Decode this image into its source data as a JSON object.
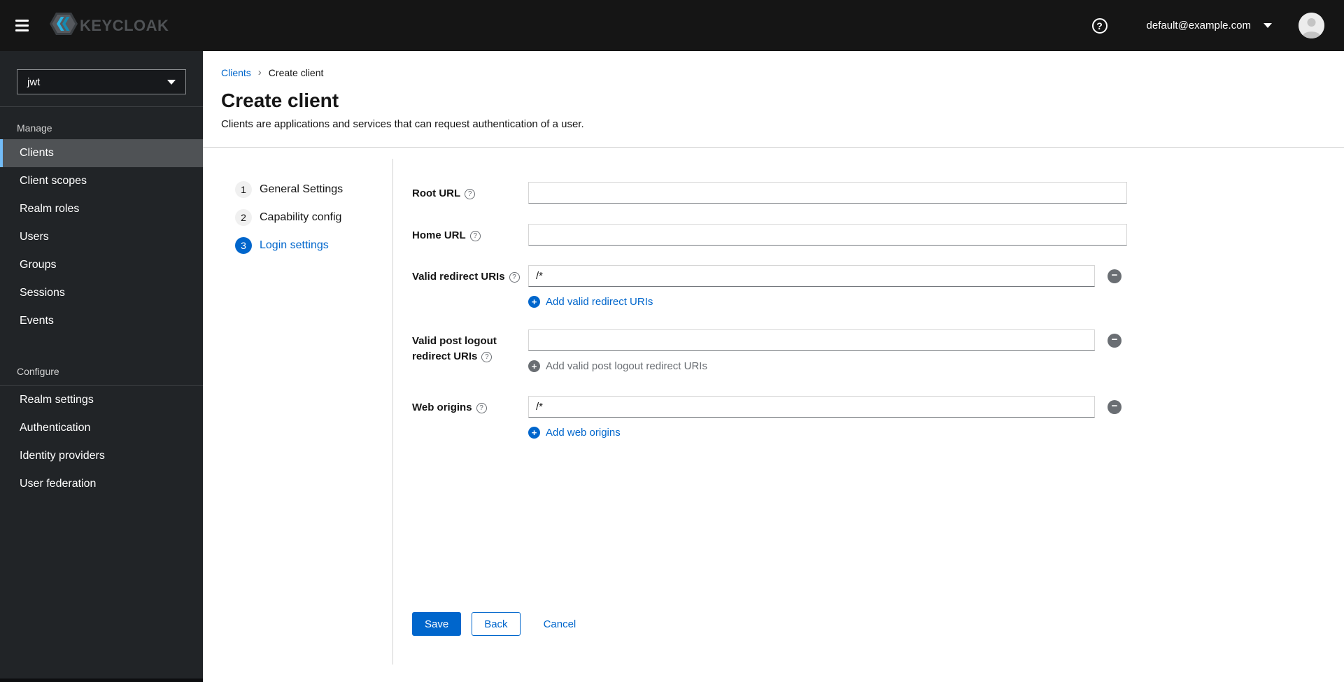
{
  "header": {
    "brand": "KEYCLOAK",
    "user_email": "default@example.com"
  },
  "icons": {
    "help_glyph": "?",
    "plus_glyph": "+",
    "minus_glyph": "−"
  },
  "sidebar": {
    "realm_selector": {
      "value": "jwt"
    },
    "sections": [
      {
        "title": "Manage",
        "items": [
          {
            "label": "Clients"
          },
          {
            "label": "Client scopes"
          },
          {
            "label": "Realm roles"
          },
          {
            "label": "Users"
          },
          {
            "label": "Groups"
          },
          {
            "label": "Sessions"
          },
          {
            "label": "Events"
          }
        ]
      },
      {
        "title": "Configure",
        "items": [
          {
            "label": "Realm settings"
          },
          {
            "label": "Authentication"
          },
          {
            "label": "Identity providers"
          },
          {
            "label": "User federation"
          }
        ]
      }
    ]
  },
  "breadcrumb": {
    "parent": "Clients",
    "separator": "›",
    "current": "Create client"
  },
  "page": {
    "title": "Create client",
    "description": "Clients are applications and services that can request authentication of a user."
  },
  "wizard": {
    "steps": [
      {
        "number": "1",
        "label": "General Settings"
      },
      {
        "number": "2",
        "label": "Capability config"
      },
      {
        "number": "3",
        "label": "Login settings"
      }
    ]
  },
  "form": {
    "fields": [
      {
        "label": "Root URL",
        "value": ""
      },
      {
        "label": "Home URL",
        "value": ""
      },
      {
        "label": "Valid redirect URIs",
        "value": "/*",
        "add_label": "Add valid redirect URIs"
      },
      {
        "label": "Valid post logout redirect URIs",
        "value": "",
        "add_label": "Add valid post logout redirect URIs"
      },
      {
        "label": "Web origins",
        "value": "/*",
        "add_label": "Add web origins"
      }
    ],
    "actions": {
      "save": "Save",
      "back": "Back",
      "cancel": "Cancel"
    }
  },
  "colors": {
    "accent_blue": "#0066cc",
    "active_nav_border": "#73bcf7",
    "masthead_bg": "#151515",
    "sidebar_bg": "#212427",
    "active_nav_bg": "#4f5255",
    "disabled_gray": "#6a6e73"
  }
}
